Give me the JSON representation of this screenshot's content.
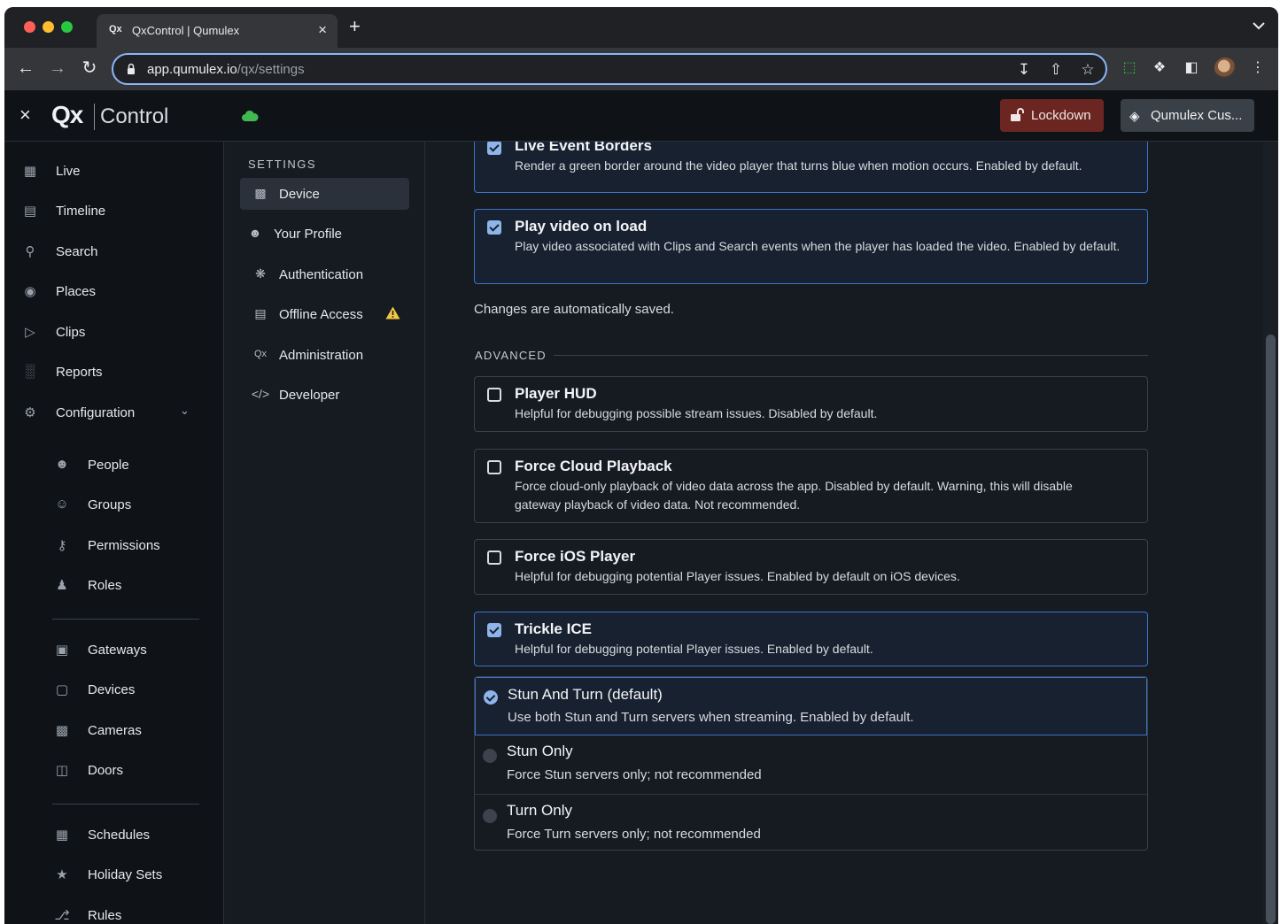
{
  "browser": {
    "tab_favicon": "Qx",
    "tab_title": "QxControl | Qumulex",
    "tab_close": "×",
    "new_tab": "+",
    "url_host": "app.qumulex.io",
    "url_path": "/qx/settings"
  },
  "header": {
    "close": "×",
    "logo_qx": "Qx",
    "logo_control": "Control",
    "lockdown_label": "Lockdown",
    "org_label": "Qumulex Cus..."
  },
  "nav": {
    "items": [
      {
        "label": "Live",
        "icon": "live-grid-icon"
      },
      {
        "label": "Timeline",
        "icon": "timeline-icon"
      },
      {
        "label": "Search",
        "icon": "search-icon"
      },
      {
        "label": "Places",
        "icon": "pin-icon"
      },
      {
        "label": "Clips",
        "icon": "clips-icon"
      },
      {
        "label": "Reports",
        "icon": "bar-chart-icon"
      },
      {
        "label": "Configuration",
        "icon": "gear-icon"
      }
    ],
    "config_items": [
      {
        "label": "People",
        "icon": "person-icon"
      },
      {
        "label": "Groups",
        "icon": "group-icon"
      },
      {
        "label": "Permissions",
        "icon": "key-icon"
      },
      {
        "label": "Roles",
        "icon": "role-icon"
      },
      {
        "label": "Gateways",
        "icon": "gateway-icon"
      },
      {
        "label": "Devices",
        "icon": "device-icon"
      },
      {
        "label": "Cameras",
        "icon": "camera-icon"
      },
      {
        "label": "Doors",
        "icon": "door-icon"
      },
      {
        "label": "Schedules",
        "icon": "calendar-icon"
      },
      {
        "label": "Holiday Sets",
        "icon": "holiday-icon"
      },
      {
        "label": "Rules",
        "icon": "branch-icon"
      }
    ]
  },
  "settings_nav": {
    "heading": "SETTINGS",
    "items": [
      {
        "label": "Device",
        "icon": "device-icon",
        "active": true
      },
      {
        "label": "Your Profile",
        "icon": "person-icon"
      },
      {
        "label": "Authentication",
        "icon": "fingerprint-icon"
      },
      {
        "label": "Offline Access",
        "icon": "storage-icon",
        "warning": true
      },
      {
        "label": "Administration",
        "icon": "qx-icon"
      },
      {
        "label": "Developer",
        "icon": "code-icon"
      }
    ]
  },
  "main": {
    "cards_top": [
      {
        "title": "Live Event Borders",
        "description": "Render a green border around the video player that turns blue when motion occurs. Enabled by default.",
        "checked": true
      },
      {
        "title": "Play video on load",
        "description": "Play video associated with Clips and Search events when the player has loaded the video. Enabled by default.",
        "checked": true
      }
    ],
    "autosave_note": "Changes are automatically saved.",
    "advanced_heading": "ADVANCED",
    "cards_advanced": [
      {
        "title": "Player HUD",
        "description": "Helpful for debugging possible stream issues. Disabled by default.",
        "checked": false
      },
      {
        "title": "Force Cloud Playback",
        "description": "Force cloud-only playback of video data across the app. Disabled by default. Warning, this will disable gateway playback of video data. Not recommended.",
        "checked": false
      },
      {
        "title": "Force iOS Player",
        "description": "Helpful for debugging potential Player issues. Enabled by default on iOS devices.",
        "checked": false
      },
      {
        "title": "Trickle ICE",
        "description": "Helpful for debugging potential Player issues. Enabled by default.",
        "checked": true
      }
    ],
    "stream_options": [
      {
        "title": "Stun And Turn (default)",
        "description": "Use both Stun and Turn servers when streaming. Enabled by default.",
        "selected": true
      },
      {
        "title": "Stun Only",
        "description": "Force Stun servers only; not recommended",
        "selected": false
      },
      {
        "title": "Turn Only",
        "description": "Force Turn servers only; not recommended",
        "selected": false
      }
    ]
  },
  "colors": {
    "accent": "#8fb4ea",
    "selected_border": "#3b73c8",
    "lockdown_bg": "#6b2622",
    "cloud_green": "#3fb950",
    "warning": "#f2c744"
  }
}
